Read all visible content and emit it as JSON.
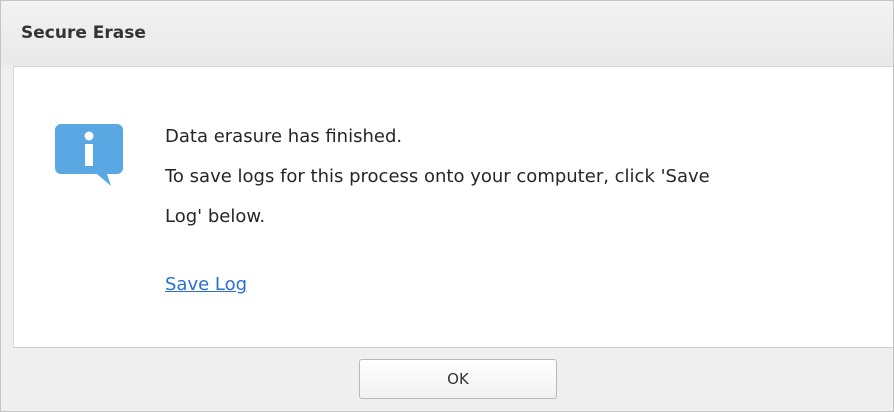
{
  "dialog": {
    "title": "Secure Erase",
    "message_lines": [
      "Data erasure has finished.",
      "To save logs for this process onto your computer, click 'Save",
      "Log' below."
    ],
    "link_label": "Save Log",
    "ok_label": "OK",
    "icon": "info-icon"
  },
  "colors": {
    "icon_blue": "#5aa8e3",
    "link_blue": "#2a6fd1",
    "background": "#efefef"
  }
}
